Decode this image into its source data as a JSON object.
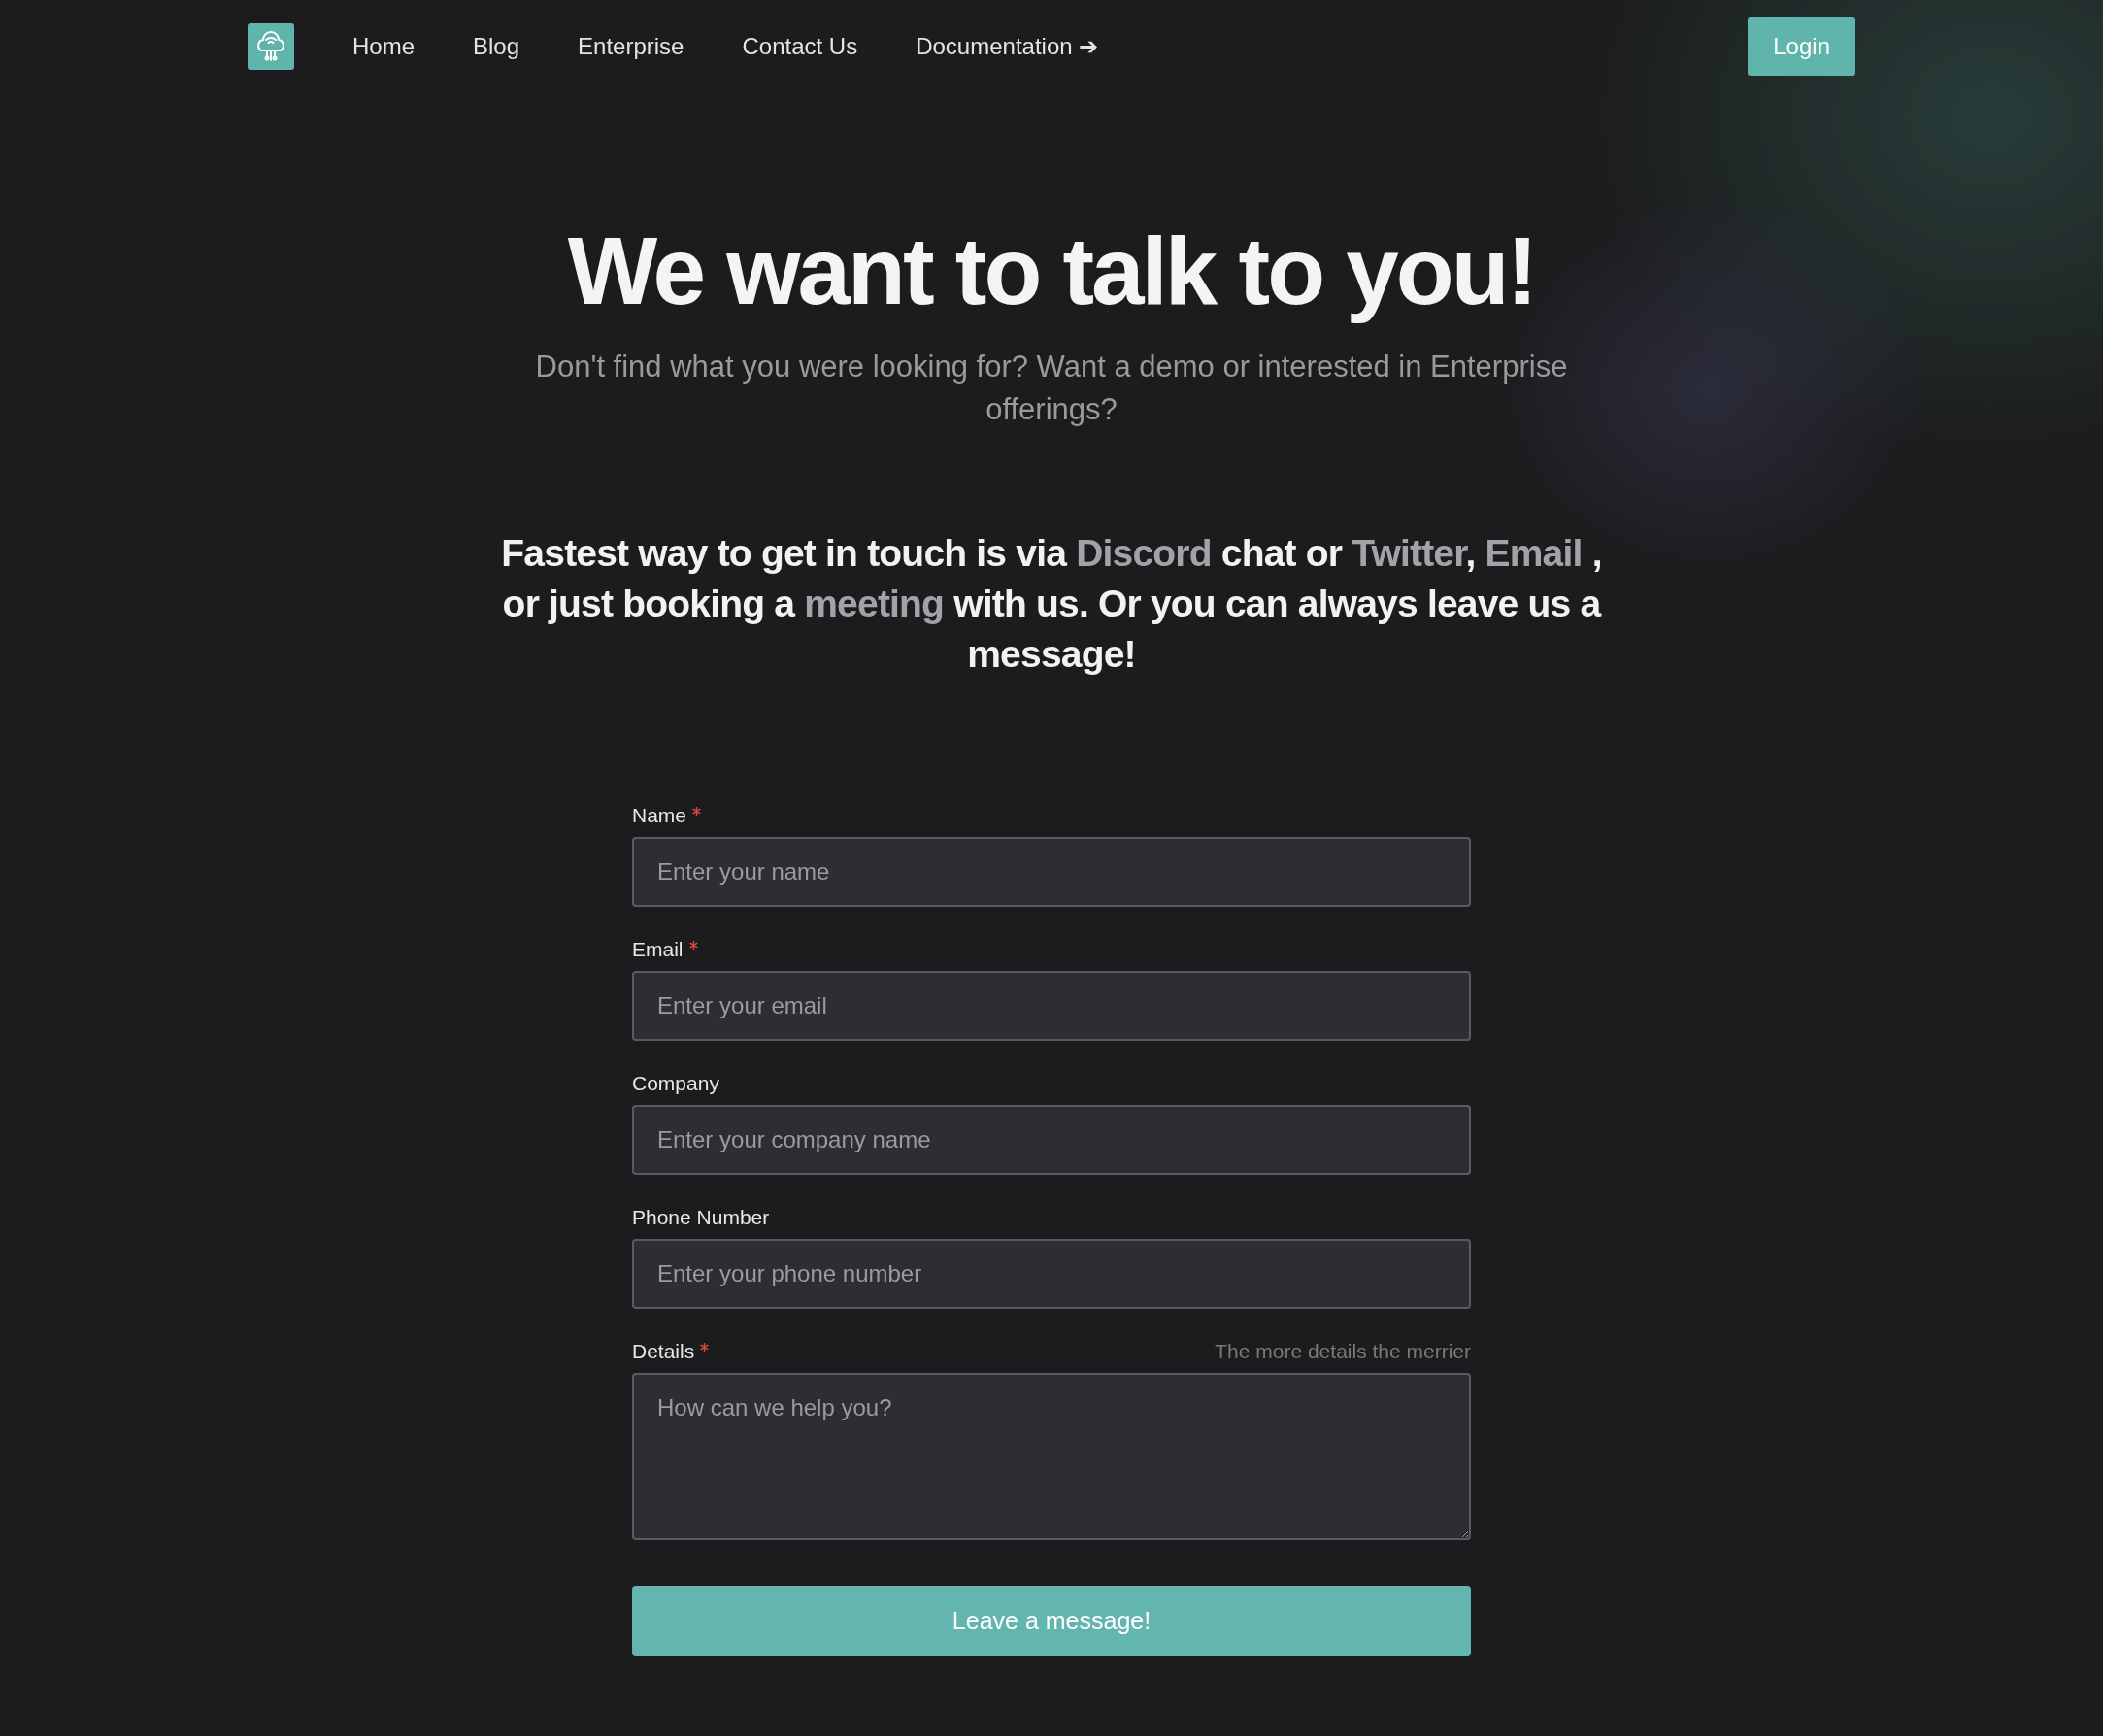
{
  "nav": {
    "links": [
      {
        "label": "Home"
      },
      {
        "label": "Blog"
      },
      {
        "label": "Enterprise"
      },
      {
        "label": "Contact Us"
      },
      {
        "label": "Documentation",
        "arrow": "➔"
      }
    ],
    "login": "Login"
  },
  "hero": {
    "title": "We want to talk to you!",
    "subtitle": "Don't find what you were looking for? Want a demo or interested in Enterprise offerings?"
  },
  "contact_text": [
    {
      "kind": "text",
      "text": "Fastest way to get in touch is via "
    },
    {
      "kind": "link",
      "text": "Discord"
    },
    {
      "kind": "text",
      "text": " chat or "
    },
    {
      "kind": "link",
      "text": "Twitter"
    },
    {
      "kind": "text",
      "text": ", "
    },
    {
      "kind": "link",
      "text": "Email"
    },
    {
      "kind": "text",
      "text": " , or just booking a "
    },
    {
      "kind": "link",
      "text": "meeting"
    },
    {
      "kind": "text",
      "text": " with us. Or you can always leave us a message!"
    }
  ],
  "form": {
    "fields": [
      {
        "kind": "input",
        "label": "Name",
        "required": true,
        "placeholder": "Enter your name"
      },
      {
        "kind": "input",
        "label": "Email",
        "required": true,
        "placeholder": "Enter your email"
      },
      {
        "kind": "input",
        "label": "Company",
        "required": false,
        "placeholder": "Enter your company name"
      },
      {
        "kind": "input",
        "label": "Phone Number",
        "required": false,
        "placeholder": "Enter your phone number"
      },
      {
        "kind": "textarea",
        "label": "Details",
        "required": true,
        "hint": "The more details the merrier",
        "placeholder": "How can we help you?"
      }
    ],
    "submit": "Leave a message!"
  }
}
